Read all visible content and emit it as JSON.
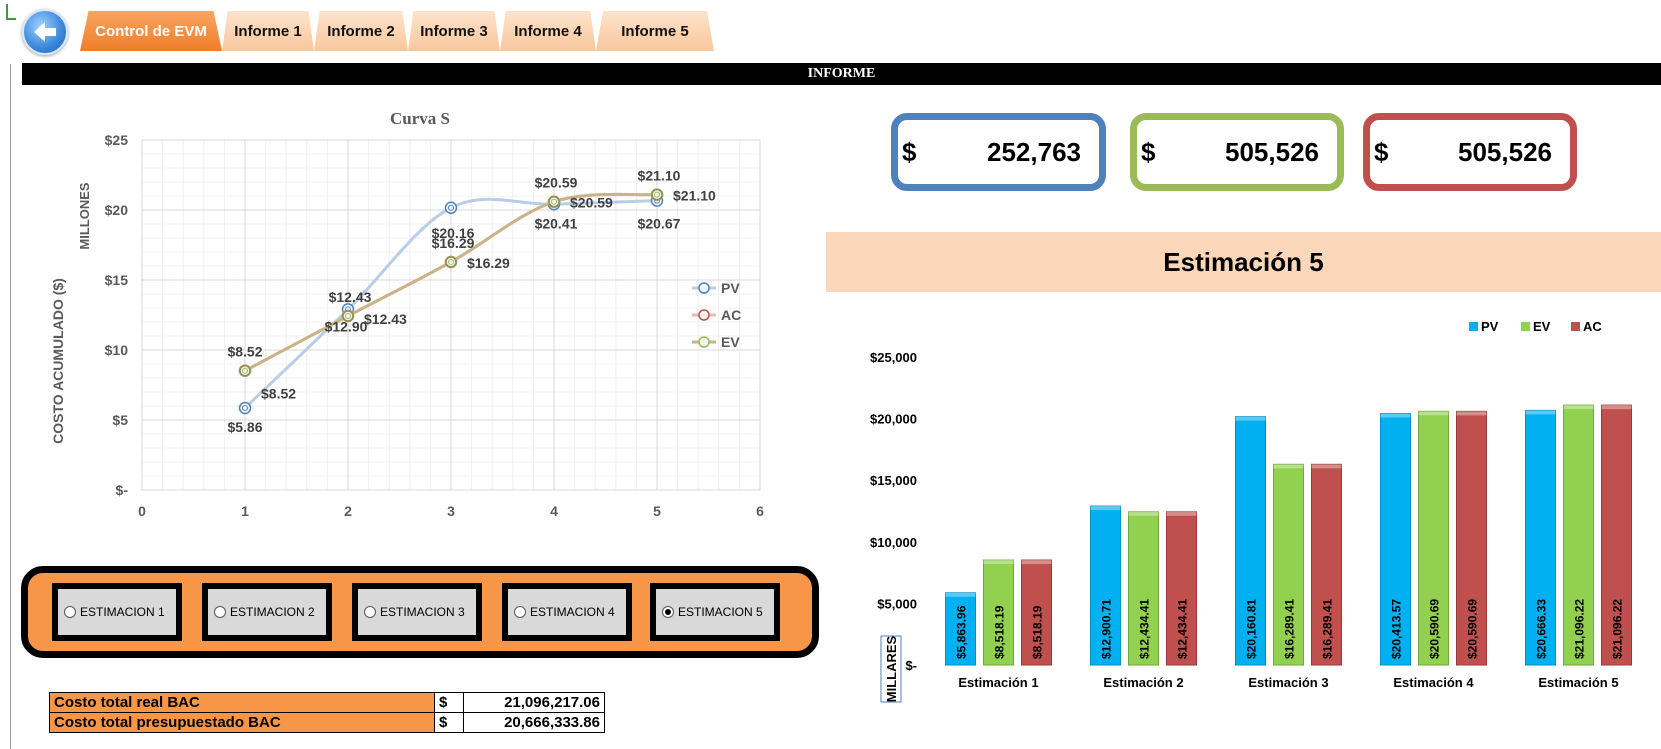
{
  "toolbar": {
    "back_icon": "back-arrow-icon",
    "tabs": [
      {
        "label": "Control de EVM",
        "active": true
      },
      {
        "label": "Informe 1",
        "active": false
      },
      {
        "label": "Informe 2",
        "active": false
      },
      {
        "label": "Informe 3",
        "active": false
      },
      {
        "label": "Informe 4",
        "active": false
      },
      {
        "label": "Informe 5",
        "active": false
      }
    ]
  },
  "header": {
    "title": "INFORME"
  },
  "kpis": [
    {
      "currency": "$",
      "value": "252,763",
      "color": "#4f81bd"
    },
    {
      "currency": "$",
      "value": "505,526",
      "color": "#9bbb59"
    },
    {
      "currency": "$",
      "value": "505,526",
      "color": "#c0504d"
    }
  ],
  "estimation_title": "Estimación 5",
  "selector": {
    "options": [
      {
        "label": "ESTIMACION 1",
        "selected": false
      },
      {
        "label": "ESTIMACION 2",
        "selected": false
      },
      {
        "label": "ESTIMACION 3",
        "selected": false
      },
      {
        "label": "ESTIMACION 4",
        "selected": false
      },
      {
        "label": "ESTIMACION 5",
        "selected": true
      }
    ]
  },
  "bac": {
    "rows": [
      {
        "label": "Costo total real BAC",
        "currency": "$",
        "value": "21,096,217.06"
      },
      {
        "label": "Costo total presupuestado BAC",
        "currency": "$",
        "value": "20,666,333.86"
      }
    ]
  },
  "chart_data": [
    {
      "type": "line",
      "title": "Curva S",
      "ylabel": "COSTO ACUMULADO ($)",
      "yunit_label": "MILLONES",
      "x": [
        1,
        2,
        3,
        4,
        5
      ],
      "xlim": [
        0,
        6
      ],
      "xticks": [
        "0",
        "1",
        "2",
        "3",
        "4",
        "5",
        "6"
      ],
      "ylim": [
        0,
        25
      ],
      "yticks": [
        "$-",
        "$5",
        "$10",
        "$15",
        "$20",
        "$25"
      ],
      "grid": true,
      "legend": "right",
      "series": [
        {
          "name": "PV",
          "color": "#4f81bd",
          "values": [
            5.86,
            12.9,
            20.16,
            20.41,
            20.67
          ],
          "labels": [
            "$5.86",
            "$12.90",
            "$20.16",
            "$20.41",
            "$20.67"
          ]
        },
        {
          "name": "AC",
          "color": "#c0504d",
          "values": [
            8.52,
            12.43,
            16.29,
            20.59,
            21.1
          ],
          "labels": [
            "$8.52",
            "$12.43",
            "$16.29",
            "$20.59",
            "$21.10"
          ]
        },
        {
          "name": "EV",
          "color": "#9bbb59",
          "values": [
            8.52,
            12.43,
            16.29,
            20.59,
            21.1
          ],
          "labels": [
            "$8.52",
            "$12.43",
            "$16.29",
            "$20.59",
            "$21.10"
          ]
        }
      ]
    },
    {
      "type": "bar",
      "categories": [
        "Estimación 1",
        "Estimación 2",
        "Estimación 3",
        "Estimación 4",
        "Estimación 5"
      ],
      "ylim": [
        0,
        25000
      ],
      "yticks": [
        "$-",
        "$5,000",
        "$10,000",
        "$15,000",
        "$20,000",
        "$25,000"
      ],
      "yunit_label": "MILLARES",
      "legend": "top-right",
      "series": [
        {
          "name": "PV",
          "color": "#00b0f0",
          "values": [
            5863.96,
            12900.71,
            20160.81,
            20413.57,
            20666.33
          ],
          "labels": [
            "$5,863.96",
            "$12,900.71",
            "$20,160.81",
            "$20,413.57",
            "$20,666.33"
          ]
        },
        {
          "name": "EV",
          "color": "#92d050",
          "values": [
            8518.19,
            12434.41,
            16289.41,
            20590.69,
            21096.22
          ],
          "labels": [
            "$8,518.19",
            "$12,434.41",
            "$16,289.41",
            "$20,590.69",
            "$21,096.22"
          ]
        },
        {
          "name": "AC",
          "color": "#c0504d",
          "values": [
            8518.19,
            12434.41,
            16289.41,
            20590.69,
            21096.22
          ],
          "labels": [
            "$8,518.19",
            "$12,434.41",
            "$16,289.41",
            "$20,590.69",
            "$21,096.22"
          ]
        }
      ]
    }
  ]
}
